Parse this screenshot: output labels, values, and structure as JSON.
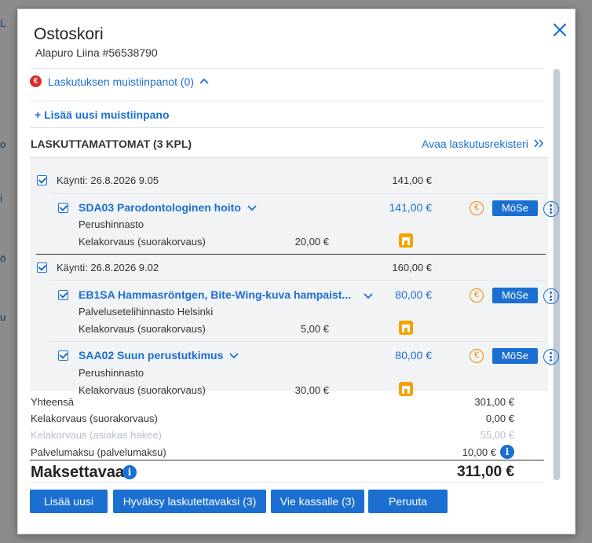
{
  "modal": {
    "title": "Ostoskori",
    "subtitle": "Alapuro Liina #56538790",
    "close_icon": "close-icon"
  },
  "notes": {
    "toggle_label": "Laskutuksen muistiinpanot (0)",
    "add_label": "+ Lisää uusi muistiinpano"
  },
  "unbilled": {
    "header": "LASKUTTAMATTOMAT (3 KPL)",
    "open_register_label": "Avaa laskutusrekisteri",
    "visits": [
      {
        "label": "Käynti: 26.8.2026 9.05",
        "amount": "141,00 €",
        "items": [
          {
            "title": "SDA03 Parodontologinen hoito",
            "amount": "141,00 €",
            "pricelist": "Perushinnasto",
            "kela_label": "Kelakorvaus (suorakorvaus)",
            "kela_amount": "20,00 €",
            "mose_label": "MöSe"
          }
        ]
      },
      {
        "label": "Käynti: 26.8.2026 9.02",
        "amount": "160,00 €",
        "items": [
          {
            "title": "EB1SA Hammasröntgen, Bite-Wing-kuva hampaist...",
            "amount": "80,00 €",
            "pricelist": "Palvelusetelihinnasto Helsinki",
            "kela_label": "Kelakorvaus (suorakorvaus)",
            "kela_amount": "5,00 €",
            "mose_label": "MöSe"
          },
          {
            "title": "SAA02 Suun perustutkimus",
            "amount": "80,00 €",
            "pricelist": "Perushinnasto",
            "kela_label": "Kelakorvaus (suorakorvaus)",
            "kela_amount": "30,00 €",
            "mose_label": "MöSe"
          }
        ]
      }
    ]
  },
  "totals": {
    "sum_label": "Yhteensä",
    "sum_value": "301,00 €",
    "kela_direct_label": "Kelakorvaus (suorakorvaus)",
    "kela_direct_value": "0,00 €",
    "kela_customer_label": "Kelakorvaus (asiakas hakee)",
    "kela_customer_value": "55,00 €",
    "service_fee_label": "Palvelumaksu (palvelumaksu)",
    "service_fee_value": "10,00 €",
    "payable_label": "Maksettavaa",
    "payable_value": "311,00 €"
  },
  "footer": {
    "add_new": "Lisää uusi",
    "approve": "Hyväksy laskutettavaksi (3)",
    "to_cashier": "Vie kassalle (3)",
    "cancel": "Peruuta"
  },
  "colors": {
    "accent": "#1b6fd1",
    "warning_red": "#d92b2b",
    "euro_orange": "#f08a00",
    "kela_orange": "#f5a200"
  }
}
